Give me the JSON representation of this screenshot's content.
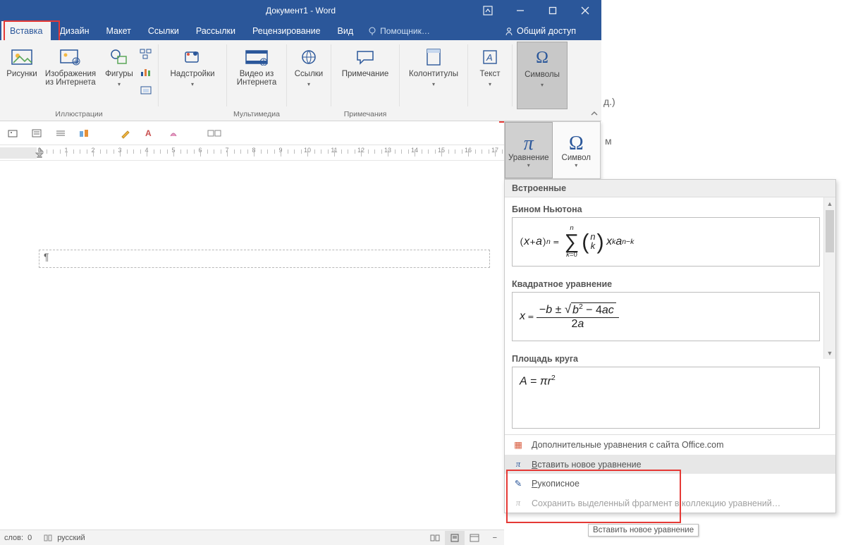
{
  "title": "Документ1 - Word",
  "tabs": {
    "insert": "Вставка",
    "design": "Дизайн",
    "layout": "Макет",
    "refs": "Ссылки",
    "mailings": "Рассылки",
    "review": "Рецензирование",
    "view": "Вид",
    "tell_me": "Помощник…",
    "share": "Общий доступ"
  },
  "ribbon": {
    "pictures": "Рисунки",
    "online_images": "Изображения из Интернета",
    "shapes": "Фигуры",
    "illustrations": "Иллюстрации",
    "addins": "Надстройки",
    "online_video": "Видео из Интернета",
    "media": "Мультимедиа",
    "links": "Ссылки",
    "comment": "Примечание",
    "comments": "Примечания",
    "header_footer": "Колонтитулы",
    "textbox": "Текст",
    "symbols": "Символы"
  },
  "symbols_dd": {
    "equation": "Уравнение",
    "symbol": "Символ"
  },
  "gallery": {
    "head": "Встроенные",
    "items": {
      "binom": "Бином Ньютона",
      "quad": "Квадратное уравнение",
      "circle": "Площадь круга"
    },
    "footer": {
      "more": "Дополнительные уравнения с сайта Office.com",
      "insert_eq": "Вставить новое уравнение",
      "ink": "Рукописное",
      "save_sel": "Сохранить выделенный фрагмент в коллекцию уравнений…"
    },
    "tooltip": "Вставить новое уравнение"
  },
  "statusbar": {
    "words_lbl": "слов:",
    "words_val": "0",
    "language": "русский"
  },
  "bg_text": {
    "right1": "д.)",
    "right2": "м"
  },
  "colors": {
    "brand": "#2b579a",
    "highlight": "#e53935"
  }
}
